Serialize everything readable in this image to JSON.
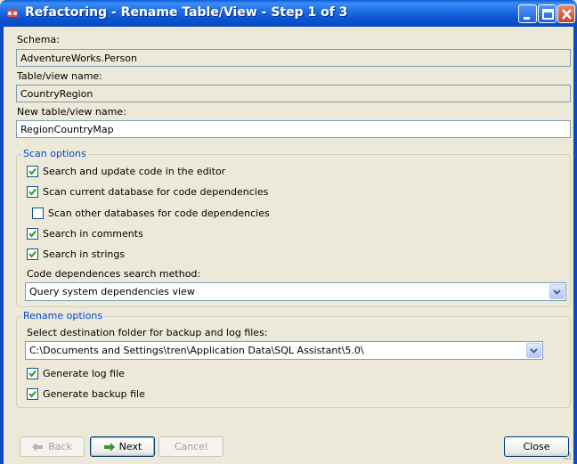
{
  "window": {
    "title": "Refactoring - Rename Table/View - Step 1 of 3"
  },
  "schema": {
    "label": "Schema:",
    "value": "AdventureWorks.Person"
  },
  "table_view": {
    "label": "Table/view name:",
    "value": "CountryRegion"
  },
  "new_name": {
    "label": "New table/view name:",
    "value": "RegionCountryMap"
  },
  "scan_options": {
    "title": "Scan options",
    "items": [
      {
        "label": "Search and update code in the editor",
        "checked": true
      },
      {
        "label": "Scan current database for code dependencies",
        "checked": true
      },
      {
        "label": "Scan other databases for code dependencies",
        "checked": false
      },
      {
        "label": "Search in comments",
        "checked": true
      },
      {
        "label": "Search in strings",
        "checked": true
      }
    ],
    "method_label": "Code dependences search method:",
    "method_value": "Query system dependencies view"
  },
  "rename_options": {
    "title": "Rename options",
    "folder_label": "Select destination folder for backup and log files:",
    "folder_value": "C:\\Documents and Settings\\tren\\Application Data\\SQL Assistant\\5.0\\",
    "items": [
      {
        "label": "Generate log file",
        "checked": true
      },
      {
        "label": "Generate backup file",
        "checked": true
      }
    ]
  },
  "buttons": {
    "back": "Back",
    "next": "Next",
    "cancel": "Cancel",
    "close": "Close"
  },
  "colors": {
    "titlebar": "#0a55d3",
    "group_title": "#0046d5",
    "check": "#21a121",
    "next_arrow": "#2f9a2f"
  }
}
